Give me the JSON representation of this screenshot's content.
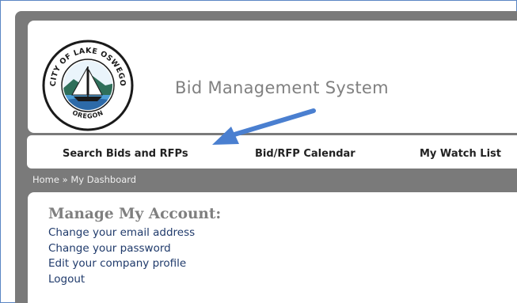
{
  "header": {
    "site_title": "Bid Management System",
    "logo": {
      "icon": "city-of-lake-oswego-seal-icon",
      "top_text": "CITY OF LAKE OSWEGO",
      "bottom_text": "OREGON"
    }
  },
  "nav": {
    "items": [
      {
        "label": "Search Bids and RFPs"
      },
      {
        "label": "Bid/RFP Calendar"
      },
      {
        "label": "My Watch List"
      }
    ]
  },
  "breadcrumb": {
    "home": "Home",
    "separator": "»",
    "current": "My Dashboard"
  },
  "account": {
    "title": "Manage My Account:",
    "links": [
      {
        "label": "Change your email address"
      },
      {
        "label": "Change your password"
      },
      {
        "label": "Edit your company profile"
      },
      {
        "label": "Logout"
      }
    ]
  },
  "annotation": {
    "icon": "pointer-arrow-icon",
    "color": "#4a7fd0"
  },
  "colors": {
    "page_background": "#7a7a7a",
    "link": "#1f3a6b",
    "frame_border": "#5b86c4"
  }
}
